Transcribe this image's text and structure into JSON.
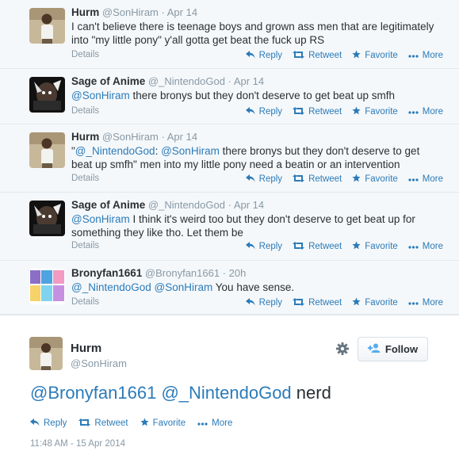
{
  "tweets": [
    {
      "name": "Hurm",
      "handle": "@SonHiram",
      "dot": "·",
      "time": "Apr 14",
      "text_parts": [
        {
          "t": "I can't believe there is teenage boys and grown ass men that are legitimately into \"my little pony\" y'all gotta get beat the fuck up RS",
          "link": false
        }
      ],
      "details": "Details"
    },
    {
      "name": "Sage of Anime",
      "handle": "@_NintendoGod",
      "dot": "·",
      "time": "Apr 14",
      "text_parts": [
        {
          "t": "@SonHiram",
          "link": true
        },
        {
          "t": " there bronys but they don't deserve to get beat up smfh",
          "link": false
        }
      ],
      "details": "Details"
    },
    {
      "name": "Hurm",
      "handle": "@SonHiram",
      "dot": "·",
      "time": "Apr 14",
      "text_parts": [
        {
          "t": "\"",
          "link": false
        },
        {
          "t": "@_NintendoGod",
          "link": true
        },
        {
          "t": ": ",
          "link": false
        },
        {
          "t": "@SonHiram",
          "link": true
        },
        {
          "t": " there bronys but they don't deserve to get beat up smfh\" men into my little pony need  a beatin or an intervention",
          "link": false
        }
      ],
      "details": "Details"
    },
    {
      "name": "Sage of Anime",
      "handle": "@_NintendoGod",
      "dot": "·",
      "time": "Apr 14",
      "text_parts": [
        {
          "t": "@SonHiram",
          "link": true
        },
        {
          "t": " I think it's weird too but they don't deserve to get beat up for something they like tho. Let them be",
          "link": false
        }
      ],
      "details": "Details"
    },
    {
      "name": "Bronyfan1661",
      "handle": "@Bronyfan1661",
      "dot": "·",
      "time": "20h",
      "text_parts": [
        {
          "t": "@_NintendoGod",
          "link": true
        },
        {
          "t": " ",
          "link": false
        },
        {
          "t": "@SonHiram",
          "link": true
        },
        {
          "t": " You have sense.",
          "link": false
        }
      ],
      "details": "Details"
    }
  ],
  "actions": {
    "reply": "Reply",
    "retweet": "Retweet",
    "favorite": "Favorite",
    "more": "More"
  },
  "permalink": {
    "name": "Hurm",
    "handle": "@SonHiram",
    "follow_label": "Follow",
    "text_parts": [
      {
        "t": "@Bronyfan1661",
        "link": true
      },
      {
        "t": " ",
        "link": false
      },
      {
        "t": "@_NintendoGod",
        "link": true
      },
      {
        "t": " nerd",
        "link": false
      }
    ],
    "timestamp": "11:48 AM - 15 Apr 2014"
  },
  "colors": {
    "link": "#2b7bb9",
    "muted": "#8899a6",
    "text": "#292f33",
    "stream_bg": "#f5f8fa"
  },
  "icons": {
    "reply": "reply-icon",
    "retweet": "retweet-icon",
    "favorite": "star-icon",
    "more": "ellipsis-icon",
    "gear": "gear-icon",
    "follow": "add-user-icon"
  }
}
